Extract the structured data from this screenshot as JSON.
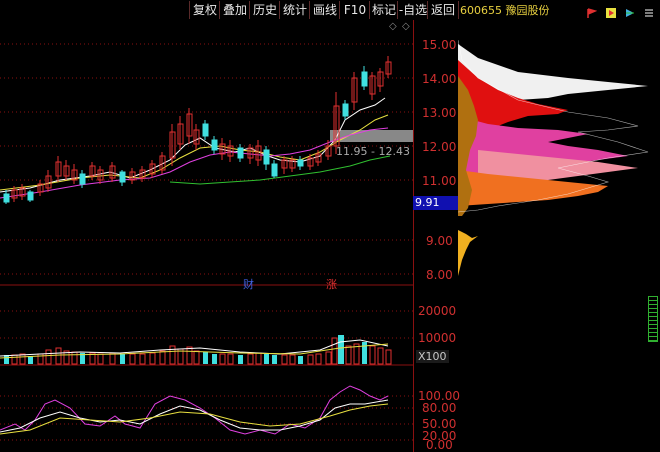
{
  "toolbar": {
    "buttons": [
      {
        "label": "复权"
      },
      {
        "label": "叠加"
      },
      {
        "label": "历史"
      },
      {
        "label": "统计"
      },
      {
        "label": "画线"
      },
      {
        "label": "F10"
      },
      {
        "label": "标记"
      },
      {
        "label": "-自选"
      },
      {
        "label": "返回"
      }
    ]
  },
  "stock": {
    "code": "600655",
    "name": "豫园股份"
  },
  "price_axis": {
    "ticks": [
      "15.00",
      "14.00",
      "13.00",
      "12.00",
      "11.00",
      "9.00",
      "8.00"
    ],
    "current_price": "9.91"
  },
  "volume_axis": {
    "ticks": [
      "20000",
      "10000"
    ],
    "unit": "X100"
  },
  "indicator_axis": {
    "ticks": [
      "100.00",
      "80.00",
      "50.00",
      "20.00",
      "0.00"
    ]
  },
  "annotations": {
    "range": "11.95 - 12.43",
    "marker_cai": "财",
    "marker_zhang": "涨",
    "diamond": "◇"
  },
  "colors": {
    "up": "#e03030",
    "down": "#40e0e0",
    "ma1": "#ffffff",
    "ma2": "#e8e040",
    "ma3": "#e040e0",
    "ma4": "#30c030",
    "grid": "#8a1010"
  }
}
